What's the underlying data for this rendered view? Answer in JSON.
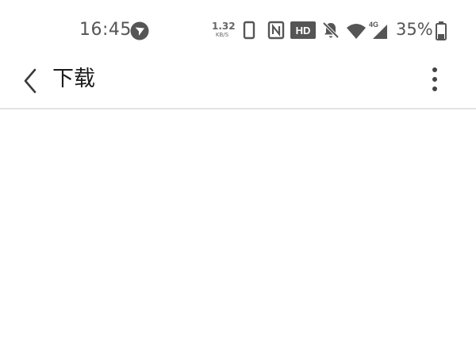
{
  "status_bar": {
    "time": "16:45",
    "network_speed": {
      "value": "1.32",
      "unit": "KB/S"
    },
    "hd_badge": "HD",
    "network_type": "4G",
    "battery_percent": "35%",
    "battery_level": 0.35,
    "icons": [
      "app-notification-icon",
      "phone-screen-icon",
      "nfc-icon",
      "hd-icon",
      "bell-off-icon",
      "wifi-icon",
      "signal-4g-icon",
      "battery-icon"
    ]
  },
  "app_bar": {
    "title": "下载",
    "back_icon": "chevron-left-icon",
    "menu_icon": "more-vertical-icon"
  },
  "colors": {
    "status_icon": "#555555",
    "title_text": "#1c1c1c",
    "divider": "#e4e4e4",
    "background": "#ffffff"
  }
}
